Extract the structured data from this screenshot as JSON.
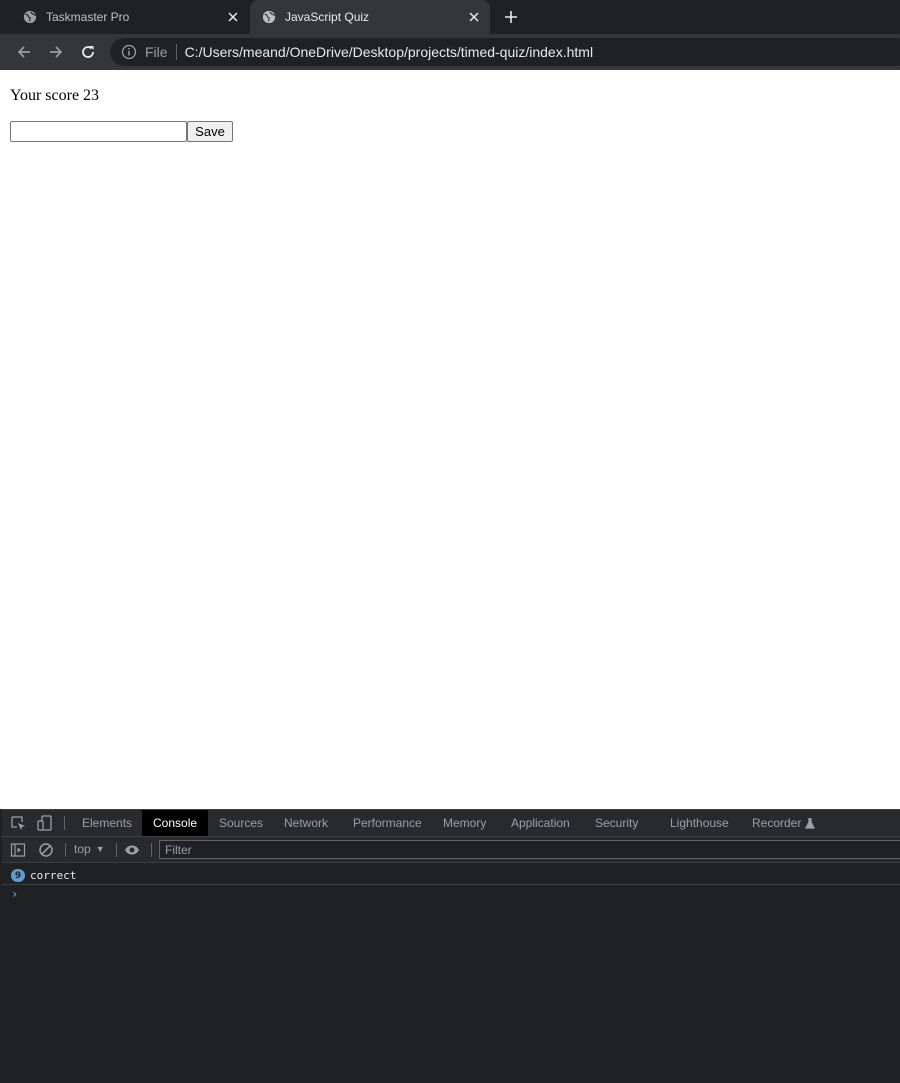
{
  "browser": {
    "tabs": [
      {
        "title": "Taskmaster Pro",
        "active": false
      },
      {
        "title": "JavaScript Quiz",
        "active": true
      }
    ],
    "address": {
      "scheme_label": "File",
      "url": "C:/Users/meand/OneDrive/Desktop/projects/timed-quiz/index.html"
    }
  },
  "page": {
    "score_text": "Your score 23",
    "name_input_value": "",
    "save_label": "Save"
  },
  "devtools": {
    "tabs": [
      "Elements",
      "Console",
      "Sources",
      "Network",
      "Performance",
      "Memory",
      "Application",
      "Security",
      "Lighthouse",
      "Recorder"
    ],
    "selected_tab": "Console",
    "context": "top",
    "filter_placeholder": "Filter",
    "log": [
      {
        "count": "9",
        "message": "correct"
      }
    ],
    "prompt_symbol": "›"
  },
  "colors": {
    "tab_strip": "#202124",
    "toolbar": "#35363a",
    "devtools_bg": "#202124",
    "console_selected_tab": "#000000",
    "log_badge": "#5e9bd0"
  }
}
